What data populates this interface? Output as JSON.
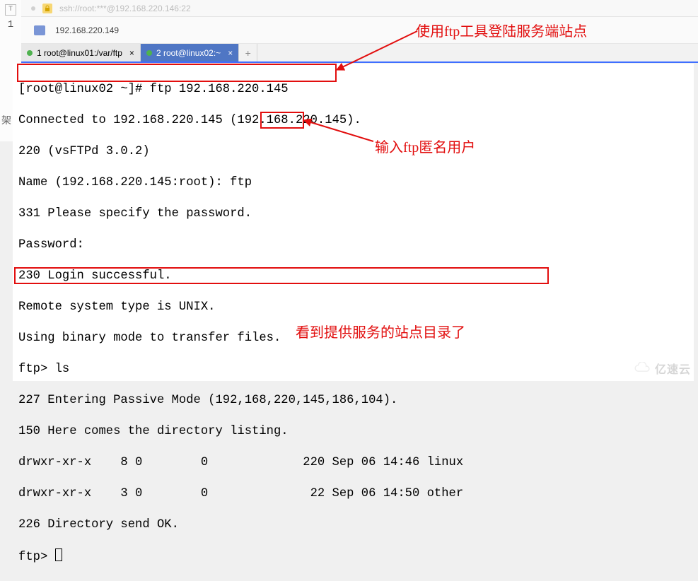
{
  "gutter": {
    "symbol": "T",
    "line_no": "1",
    "arrow_glyph": "⟫"
  },
  "title_bar": {
    "text": "ssh://root:***@192.168.220.146:22"
  },
  "sub_bar": {
    "text": "192.168.220.149"
  },
  "tabs": [
    {
      "status": "ok",
      "label": "1 root@linux01:/var/ftp",
      "active": false,
      "close": "×"
    },
    {
      "status": "ok",
      "label": "2 root@linux02:~",
      "active": true,
      "close": "×"
    }
  ],
  "tab_add": "+",
  "terminal": {
    "prompt": "[root@linux02 ~]# ",
    "cmd1": "ftp 192.168.220.145",
    "l1": "Connected to 192.168.220.145 (192.168.220.145).",
    "l2": "220 (vsFTPd 3.0.2)",
    "name_prefix": "Name (192.168.220.145:root): ",
    "name_input": "ftp",
    "l4": "331 Please specify the password.",
    "l5": "Password:",
    "l6": "230 Login successful.",
    "l7": "Remote system type is UNIX.",
    "l8": "Using binary mode to transfer files.",
    "l9": "ftp> ls",
    "l10": "227 Entering Passive Mode (192,168,220,145,186,104).",
    "l11": "150 Here comes the directory listing.",
    "row1": "drwxr-xr-x    8 0        0             220 Sep 06 14:46 linux",
    "row2": "drwxr-xr-x    3 0        0              22 Sep 06 14:50 other",
    "l14": "226 Directory send OK.",
    "ftp_prompt": "ftp> "
  },
  "annotations": {
    "a1": "使用ftp工具登陆服务端站点",
    "a2": "输入ftp匿名用户",
    "a3": "看到提供服务的站点目录了"
  },
  "watermark": "亿速云"
}
